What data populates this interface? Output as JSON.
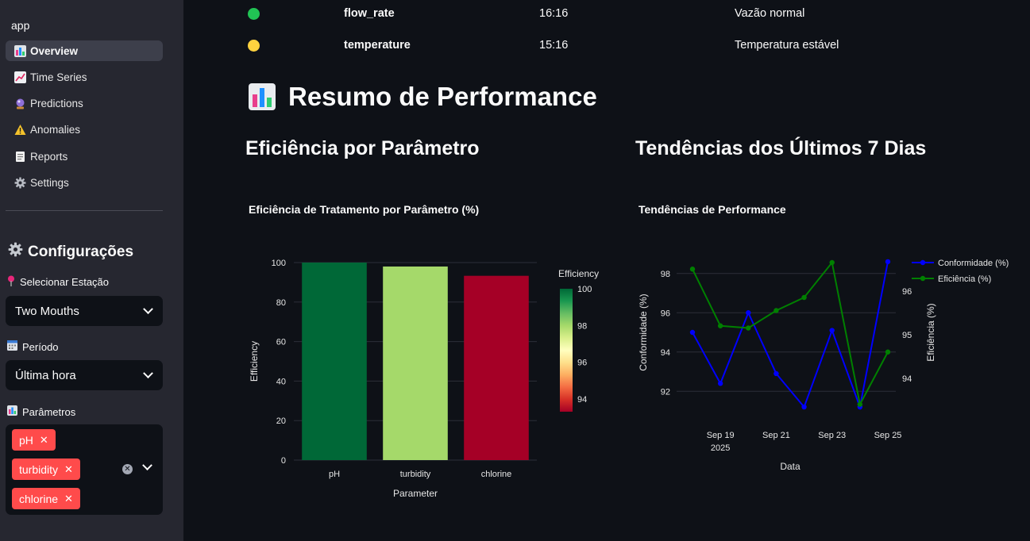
{
  "sidebar": {
    "app_label": "app",
    "nav": [
      {
        "label": "Overview",
        "icon": "bar-chart-icon",
        "active": true
      },
      {
        "label": "Time Series",
        "icon": "trend-chart-icon",
        "active": false
      },
      {
        "label": "Predictions",
        "icon": "crystal-ball-icon",
        "active": false
      },
      {
        "label": "Anomalies",
        "icon": "warning-icon",
        "active": false
      },
      {
        "label": "Reports",
        "icon": "document-icon",
        "active": false
      },
      {
        "label": "Settings",
        "icon": "gear-icon",
        "active": false
      }
    ],
    "config_title": "Configurações",
    "station_label": "Selecionar Estação",
    "station_value": "Two Mouths",
    "period_label": "Período",
    "period_value": "Última hora",
    "params_label": "Parâmetros",
    "params": [
      "pH",
      "turbidity",
      "chlorine"
    ]
  },
  "status": [
    {
      "name": "flow_rate",
      "time": "16:16",
      "message": "Vazão normal",
      "color": "#21c354"
    },
    {
      "name": "temperature",
      "time": "15:16",
      "message": "Temperatura estável",
      "color": "#ffd23f"
    }
  ],
  "main": {
    "heading": "Resumo de Performance",
    "left_heading": "Eficiência por Parâmetro",
    "right_heading": "Tendências dos Últimos 7 Dias"
  },
  "chart_data": [
    {
      "type": "bar",
      "title": "Eficiência de Tratamento por Parâmetro (%)",
      "categories": [
        "pH",
        "turbidity",
        "chlorine"
      ],
      "values": [
        100,
        98,
        93.3
      ],
      "xlabel": "Parameter",
      "ylabel": "Efficiency",
      "ylim": [
        0,
        100
      ],
      "yticks": [
        0,
        20,
        40,
        60,
        80,
        100
      ],
      "grid": true,
      "colorbar": {
        "title": "Efficiency",
        "ticks": [
          94,
          96,
          98,
          100
        ],
        "range": [
          93.3,
          100
        ],
        "colorscale": "RdYlGn"
      }
    },
    {
      "type": "line",
      "title": "Tendências de Performance",
      "xlabel": "Data",
      "x": [
        "2025-09-18",
        "2025-09-19",
        "2025-09-20",
        "2025-09-21",
        "2025-09-22",
        "2025-09-23",
        "2025-09-24",
        "2025-09-25"
      ],
      "xticks": [
        "Sep 19",
        "Sep 21",
        "Sep 23",
        "Sep 25"
      ],
      "xtick_year": "2025",
      "series": [
        {
          "name": "Conformidade (%)",
          "axis": "left",
          "color": "#0000ff",
          "values": [
            95.0,
            92.4,
            96.0,
            92.9,
            91.2,
            95.1,
            91.2,
            98.6
          ]
        },
        {
          "name": "Eficiência (%)",
          "axis": "right",
          "color": "#008000",
          "values": [
            96.5,
            95.2,
            95.15,
            95.55,
            95.85,
            96.65,
            93.4,
            94.6
          ]
        }
      ],
      "ylabel": "Conformidade (%)",
      "ylim": [
        91.0,
        99.0
      ],
      "yticks": [
        92,
        94,
        96,
        98
      ],
      "y2label": "Eficiência (%)",
      "y2lim": [
        93.25,
        96.85
      ],
      "y2ticks": [
        94,
        95,
        96
      ],
      "legend": "top-right",
      "grid": true
    }
  ]
}
